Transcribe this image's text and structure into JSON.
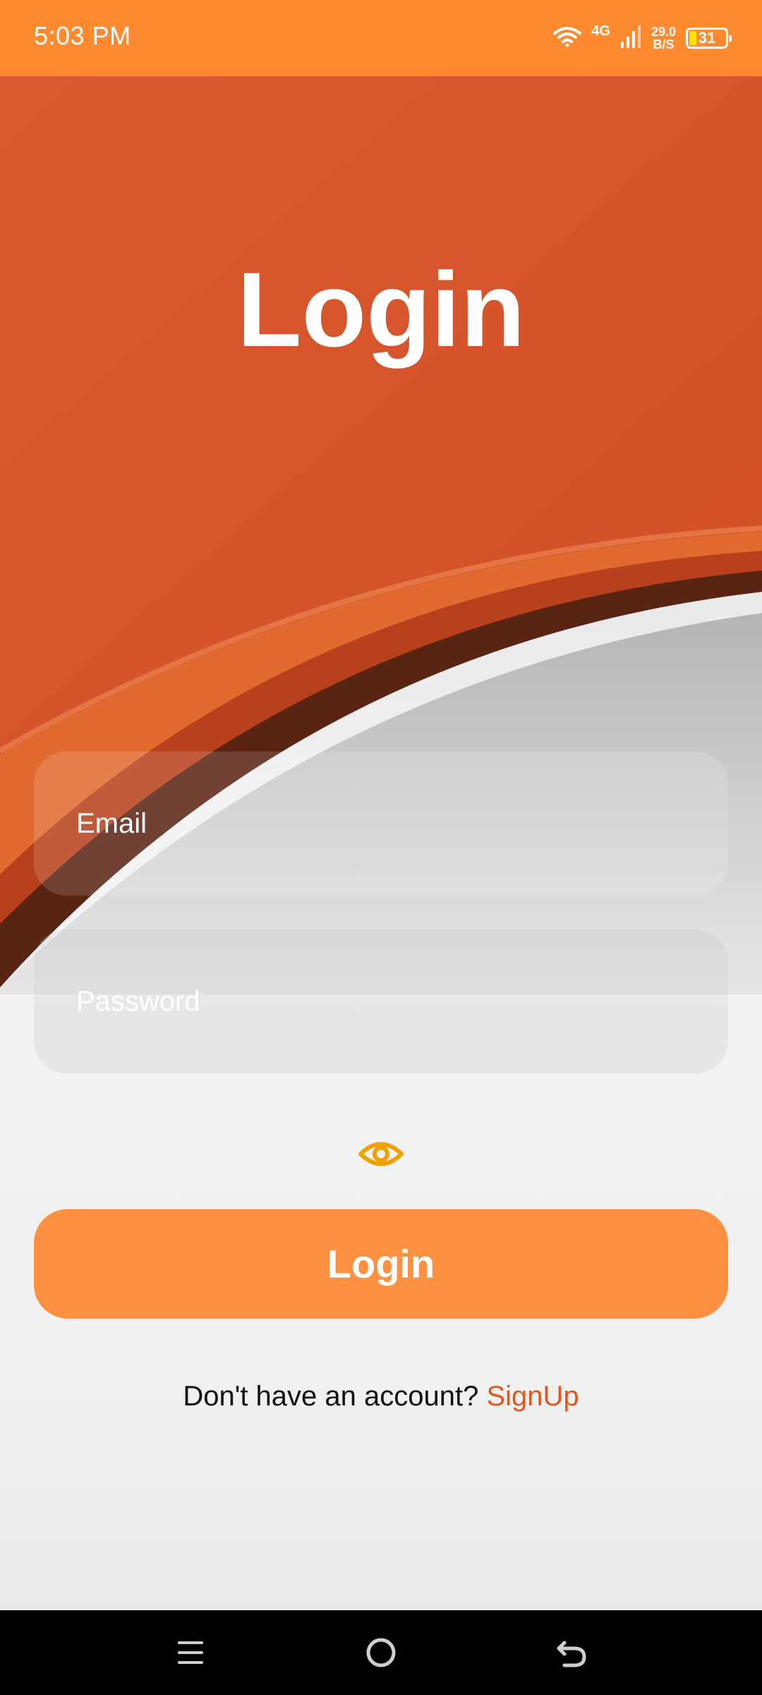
{
  "status_bar": {
    "time": "5:03 PM",
    "network": "4G",
    "speed_value": "29.0",
    "speed_unit": "B/S",
    "battery": "31"
  },
  "title": "Login",
  "email": {
    "placeholder": "Email",
    "value": ""
  },
  "password": {
    "placeholder": "Password",
    "value": ""
  },
  "toggle_icon": "eye-icon",
  "login_button": {
    "label": "Login"
  },
  "signup_prompt": {
    "text": "Don't have an account?",
    "link": "SignUp"
  },
  "nav_bar": {
    "icons": [
      "menu-icon",
      "home-icon",
      "back-icon"
    ]
  },
  "colors": {
    "status_bar": "#ff8a2f",
    "header_orange": "#d5552d",
    "button": "#fd9141",
    "accent_link": "#e2581c",
    "eye_icon": "#f0a000"
  }
}
